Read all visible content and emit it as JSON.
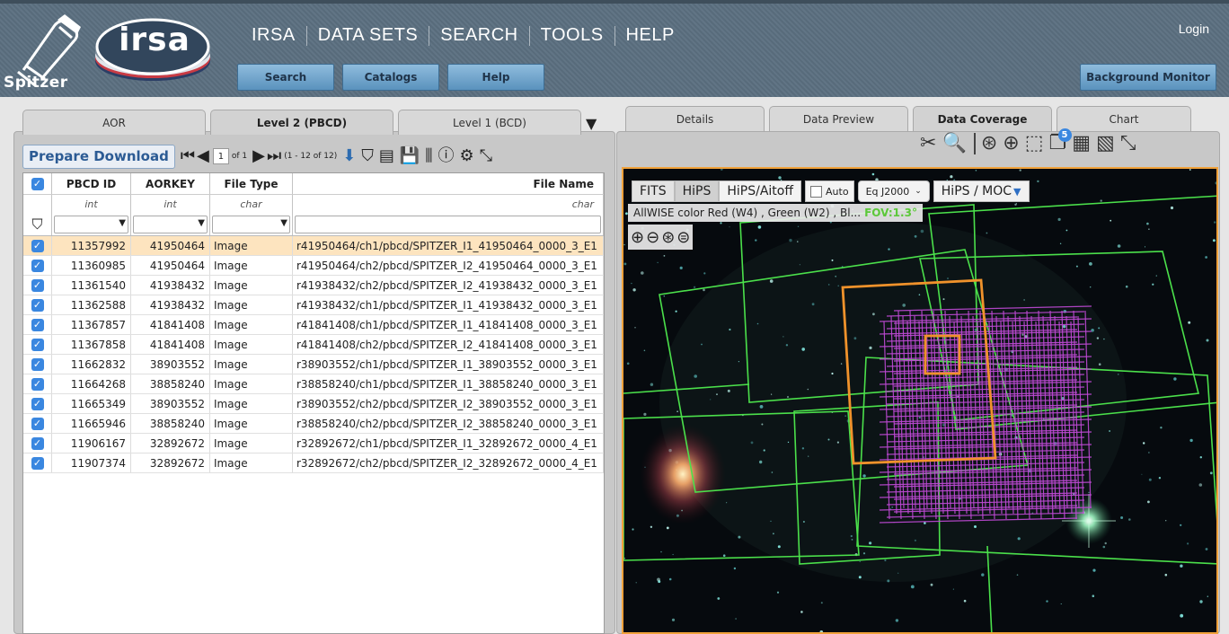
{
  "header": {
    "spitzer_label": "Spitzer",
    "irsa_logo": "irsa",
    "nav": [
      "IRSA",
      "DATA SETS",
      "SEARCH",
      "TOOLS",
      "HELP"
    ],
    "login": "Login",
    "sub_buttons": [
      "Search",
      "Catalogs",
      "Help"
    ],
    "background_monitor": "Background Monitor"
  },
  "left_panel": {
    "tabs": [
      {
        "label": "AOR",
        "active": false
      },
      {
        "label": "Level 2 (PBCD)",
        "active": true
      },
      {
        "label": "Level 1 (BCD)",
        "active": false
      }
    ],
    "toolbar": {
      "prepare_download": "Prepare Download",
      "page_value": "1",
      "page_of": "of 1",
      "range": "(1 - 12 of 12)"
    },
    "table": {
      "columns": [
        "PBCD ID",
        "AORKEY",
        "File Type",
        "File Name"
      ],
      "types": [
        "int",
        "int",
        "char",
        "char"
      ],
      "rows": [
        [
          "11357992",
          "41950464",
          "Image",
          "r41950464/ch1/pbcd/SPITZER_I1_41950464_0000_3_E1"
        ],
        [
          "11360985",
          "41950464",
          "Image",
          "r41950464/ch2/pbcd/SPITZER_I2_41950464_0000_3_E1"
        ],
        [
          "11361540",
          "41938432",
          "Image",
          "r41938432/ch2/pbcd/SPITZER_I2_41938432_0000_3_E1"
        ],
        [
          "11362588",
          "41938432",
          "Image",
          "r41938432/ch1/pbcd/SPITZER_I1_41938432_0000_3_E1"
        ],
        [
          "11367857",
          "41841408",
          "Image",
          "r41841408/ch1/pbcd/SPITZER_I1_41841408_0000_3_E1"
        ],
        [
          "11367858",
          "41841408",
          "Image",
          "r41841408/ch2/pbcd/SPITZER_I2_41841408_0000_3_E1"
        ],
        [
          "11662832",
          "38903552",
          "Image",
          "r38903552/ch1/pbcd/SPITZER_I1_38903552_0000_3_E1"
        ],
        [
          "11664268",
          "38858240",
          "Image",
          "r38858240/ch1/pbcd/SPITZER_I1_38858240_0000_3_E1"
        ],
        [
          "11665349",
          "38903552",
          "Image",
          "r38903552/ch2/pbcd/SPITZER_I2_38903552_0000_3_E1"
        ],
        [
          "11665946",
          "38858240",
          "Image",
          "r38858240/ch2/pbcd/SPITZER_I2_38858240_0000_3_E1"
        ],
        [
          "11906167",
          "32892672",
          "Image",
          "r32892672/ch1/pbcd/SPITZER_I1_32892672_0000_4_E1"
        ],
        [
          "11907374",
          "32892672",
          "Image",
          "r32892672/ch2/pbcd/SPITZER_I2_32892672_0000_4_E1"
        ]
      ],
      "selected_row": 0
    }
  },
  "right_panel": {
    "tabs": [
      {
        "label": "Details",
        "active": false
      },
      {
        "label": "Data Preview",
        "active": false
      },
      {
        "label": "Data Coverage",
        "active": true
      },
      {
        "label": "Chart",
        "active": false
      }
    ],
    "layer_count": "5",
    "viewer": {
      "modes": [
        "FITS",
        "HiPS",
        "HiPS/Aitoff"
      ],
      "auto_label": "Auto",
      "coord_sys": "Eq J2000",
      "hips_moc": "HiPS / MOC",
      "image_title": "AllWISE color Red (W4) , Green (W2) , Bl...",
      "fov": "FOV:1.3°"
    }
  },
  "colors": {
    "banner": "#5b6f80",
    "selected_row": "#fde4bf",
    "checkbox": "#3a87e0",
    "viewer_border": "#f1a23b",
    "footprint_green": "#4be04b",
    "footprint_magenta": "#c04ad6",
    "footprint_orange": "#f0922b"
  }
}
